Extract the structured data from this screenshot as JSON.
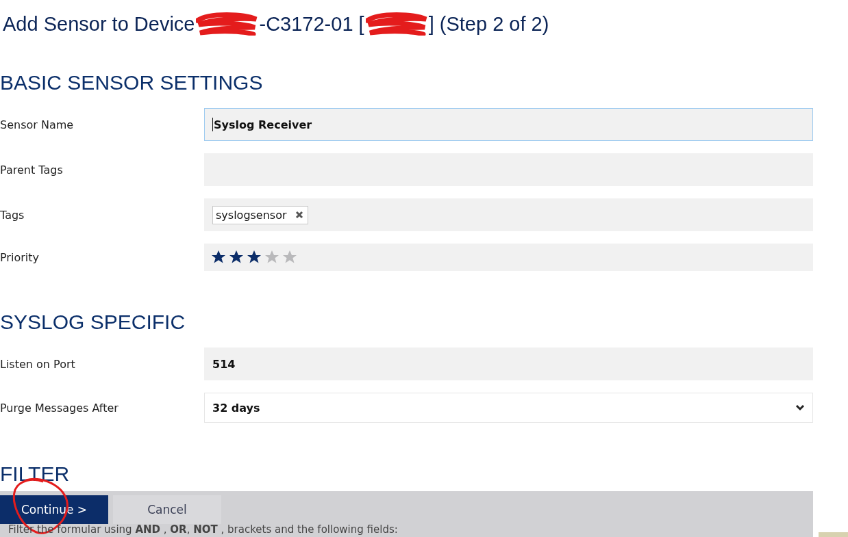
{
  "title": {
    "parts": [
      {
        "kind": "text",
        "text": "Add Sensor to Device"
      },
      {
        "kind": "redaction"
      },
      {
        "kind": "text",
        "text": "-C3172-01 ["
      },
      {
        "kind": "redaction"
      },
      {
        "kind": "text",
        "text": "] (Step 2 of 2)"
      }
    ]
  },
  "sections": [
    {
      "heading": "BASIC SENSOR SETTINGS",
      "fields": [
        {
          "label": "Sensor Name",
          "kind": "text",
          "value": "Syslog Receiver",
          "focused": true
        },
        {
          "label": "Parent Tags",
          "kind": "text",
          "focused": false
        },
        {
          "label": "Tags",
          "kind": "tags",
          "tags": [
            "syslogsensor"
          ]
        },
        {
          "label": "Priority",
          "kind": "stars",
          "stars": 3
        }
      ]
    },
    {
      "heading": "SYSLOG SPECIFIC",
      "fields": [
        {
          "label": "Listen on Port",
          "kind": "text",
          "value": "514",
          "focused": false
        },
        {
          "label": "Purge Messages After",
          "kind": "select",
          "value": "32 days"
        }
      ]
    },
    {
      "heading": "FILTER",
      "description": "Filter the formular using **AND** , **OR**, **NOT** , brackets and the following fields:"
    }
  ],
  "buttons": [
    {
      "label": "Continue >",
      "kind": "primary"
    },
    {
      "label": "Cancel",
      "kind": "secondary"
    }
  ],
  "annotations": [
    {
      "kind": "circle"
    }
  ]
}
